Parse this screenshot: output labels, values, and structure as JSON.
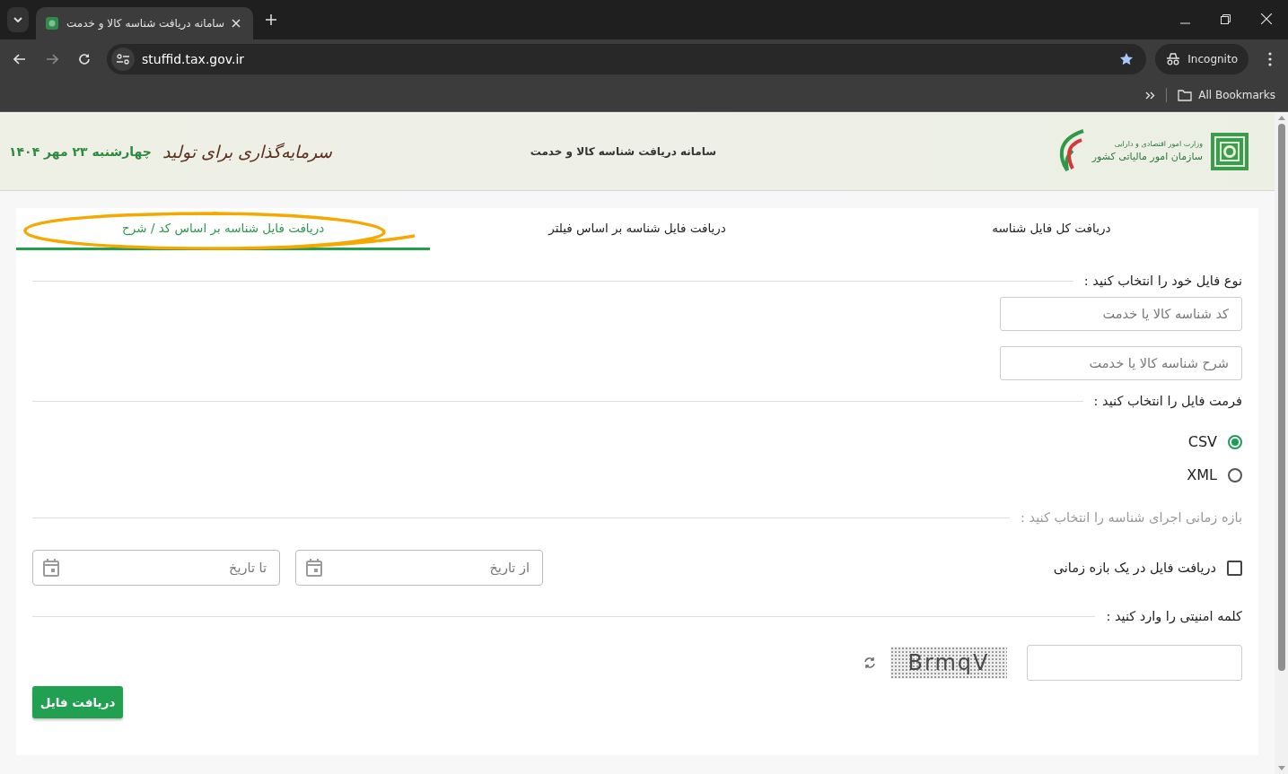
{
  "browser": {
    "tab_title": "سامانه دریافت شناسه کالا و خدمت",
    "url": "stuffid.tax.gov.ir",
    "profile": "Incognito",
    "bookmarks": "All Bookmarks"
  },
  "header": {
    "org_line1": "وزارت امور اقتصادی و دارایی",
    "org_line2": "سازمان امور مالیاتی کشور",
    "title": "سامانه دریافت شناسه کالا و خدمت",
    "slogan": "سرمایه‌گذاری برای تولید",
    "date": "چهارشنبه ۲۳ مهر ۱۴۰۴"
  },
  "tabs": [
    {
      "label": "دریافت کل فایل شناسه",
      "selected": false,
      "highlighted": false
    },
    {
      "label": "دریافت فایل شناسه بر اساس فیلتر",
      "selected": false,
      "highlighted": false
    },
    {
      "label": "دریافت فایل شناسه بر اساس کد / شرح",
      "selected": true,
      "highlighted": true
    }
  ],
  "file_type": {
    "heading": "نوع فایل خود را انتخاب کنید :",
    "fields": [
      {
        "placeholder": "کد شناسه کالا یا خدمت"
      },
      {
        "placeholder": "شرح شناسه کالا یا خدمت"
      }
    ]
  },
  "format": {
    "heading": "فرمت فایل را انتخاب کنید :",
    "options": [
      {
        "label": "CSV",
        "selected": true
      },
      {
        "label": "XML",
        "selected": false
      }
    ]
  },
  "date_range": {
    "heading": "بازه زمانی اجرای شناسه را انتخاب کنید :",
    "disabled": true,
    "checkbox": {
      "label": "دریافت فایل در یک بازه زمانی",
      "checked": false
    },
    "from": {
      "placeholder": "از تاریخ"
    },
    "to": {
      "placeholder": "تا تاریخ"
    }
  },
  "captcha": {
    "heading": "کلمه امنیتی را وارد کنید :",
    "code": "BrmqV"
  },
  "submit": "دریافت فایل"
}
